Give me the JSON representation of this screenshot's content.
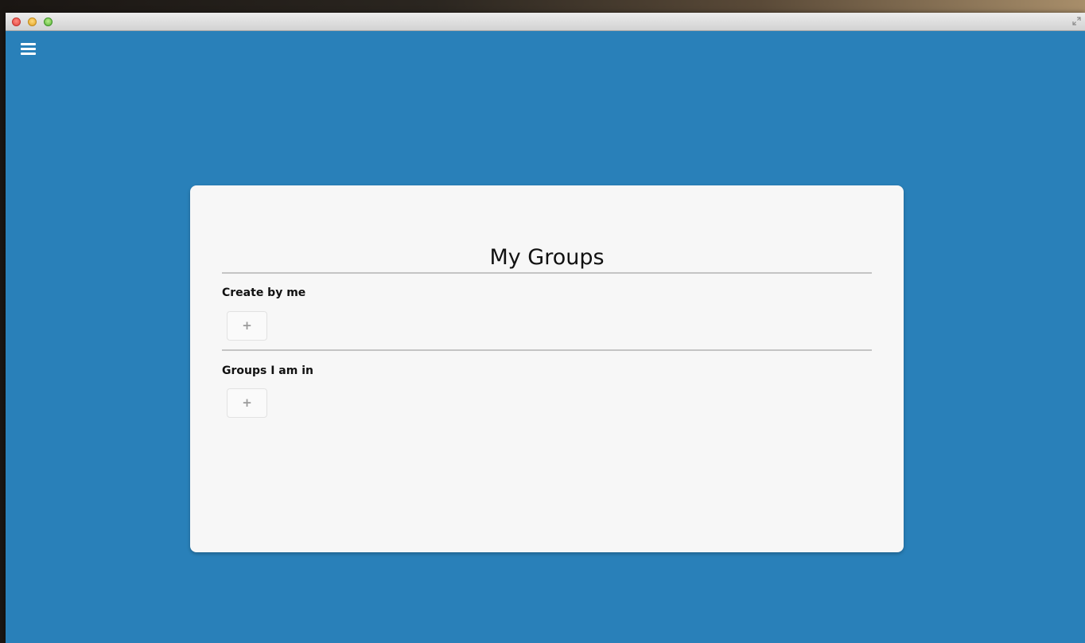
{
  "window": {
    "controls": [
      "close-icon",
      "minimize-icon",
      "zoom-icon"
    ],
    "fullscreen_icon": "fullscreen-icon"
  },
  "toolbar": {
    "menu_icon": "hamburger-menu-icon"
  },
  "colors": {
    "background": "#2980b9",
    "card": "#f7f7f7",
    "divider": "#c4c4c4"
  },
  "card": {
    "title": "My Groups",
    "sections": [
      {
        "heading": "Create by me",
        "add_label": "+"
      },
      {
        "heading": "Groups I am in",
        "add_label": "+"
      }
    ]
  }
}
